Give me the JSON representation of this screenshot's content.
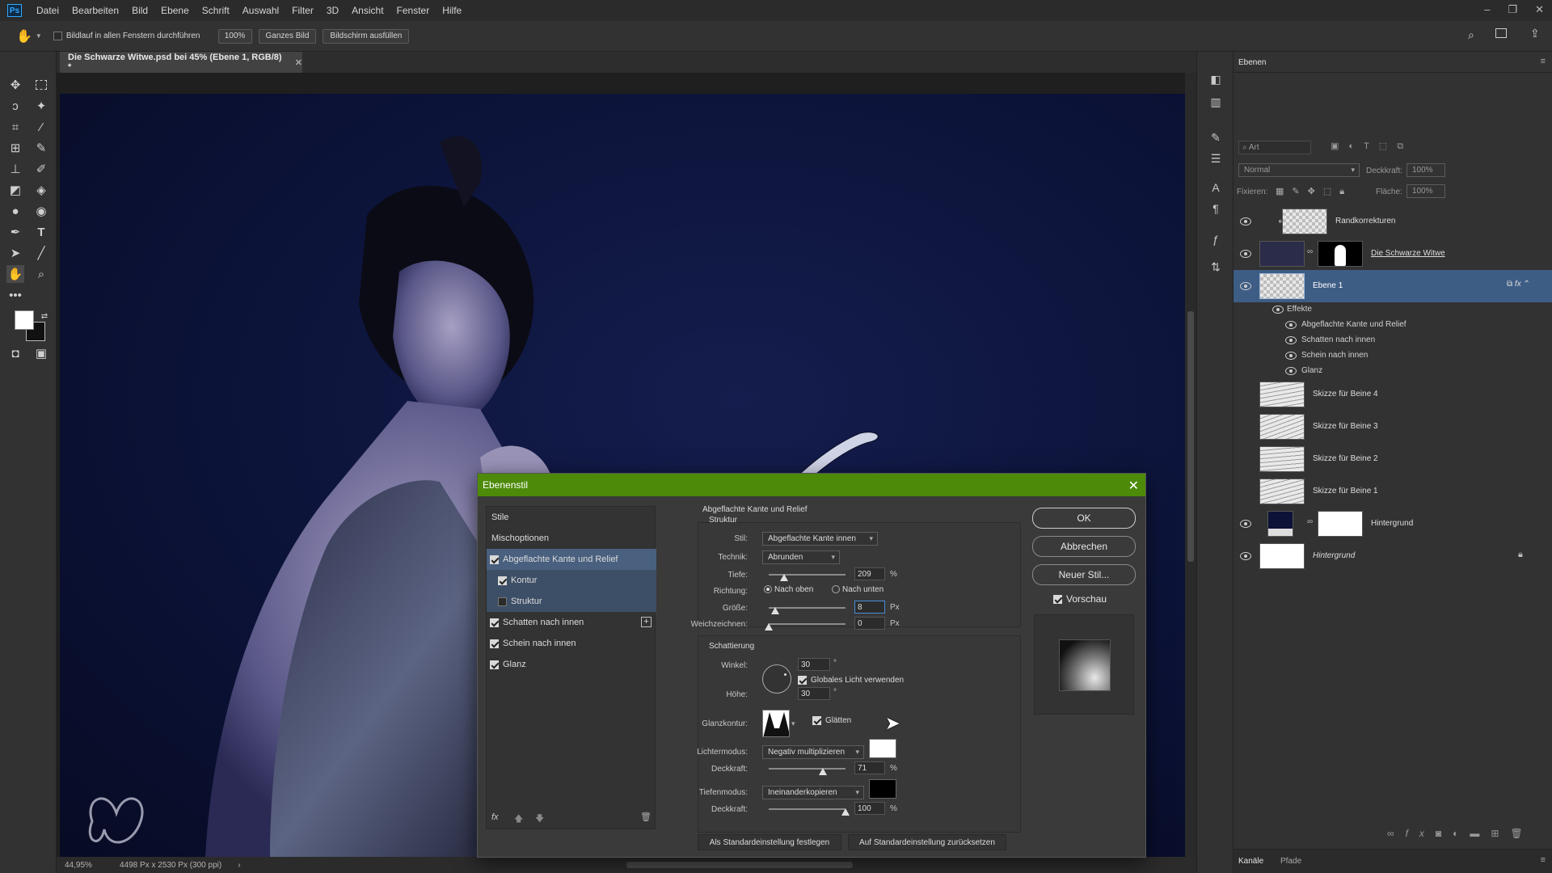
{
  "menu": {
    "logo": "Ps",
    "items": [
      "Datei",
      "Bearbeiten",
      "Bild",
      "Ebene",
      "Schrift",
      "Auswahl",
      "Filter",
      "3D",
      "Ansicht",
      "Fenster",
      "Hilfe"
    ]
  },
  "options": {
    "scroll_all_label": "Bildlauf in allen Fenstern durchführen",
    "zoom": "100%",
    "fit_label": "Ganzes Bild",
    "fill_label": "Bildschirm ausfüllen"
  },
  "document": {
    "tab_title": "Die Schwarze Witwe.psd bei 45% (Ebene 1, RGB/8) *",
    "zoom_status": "44,95%",
    "size_status": "4498 Px x 2530 Px (300 ppi)"
  },
  "layers_panel": {
    "title": "Ebenen",
    "search_placeholder": "Art",
    "blend_mode": "Normal",
    "opacity_label": "Deckkraft:",
    "opacity_value": "100%",
    "lock_label": "Fixieren:",
    "fill_label": "Fläche:",
    "fill_value": "100%",
    "layers": [
      {
        "name": "Randkorrekturen",
        "visible": true
      },
      {
        "name": "Die Schwarze Witwe",
        "visible": true
      },
      {
        "name": "Ebene 1",
        "visible": true,
        "selected": true
      },
      {
        "name": "Skizze für Beine 4",
        "visible": false
      },
      {
        "name": "Skizze für Beine 3",
        "visible": false
      },
      {
        "name": "Skizze für Beine 2",
        "visible": false
      },
      {
        "name": "Skizze für Beine 1",
        "visible": false
      },
      {
        "name": "Hintergrund",
        "visible": true
      },
      {
        "name": "Hintergrund",
        "visible": true,
        "locked": true
      }
    ],
    "effects_label": "Effekte",
    "effects": [
      "Abgeflachte Kante und Relief",
      "Schatten nach innen",
      "Schein nach innen",
      "Glanz"
    ],
    "bottom_tabs": [
      "Kanäle",
      "Pfade"
    ]
  },
  "dialog": {
    "title": "Ebenenstil",
    "styles_header": "Stile",
    "blend_options": "Mischoptionen",
    "style_items": [
      {
        "label": "Abgeflachte Kante und Relief",
        "checked": true
      },
      {
        "label": "Kontur",
        "checked": true
      },
      {
        "label": "Struktur",
        "checked": false
      },
      {
        "label": "Schatten nach innen",
        "checked": true
      },
      {
        "label": "Schein nach innen",
        "checked": true
      },
      {
        "label": "Glanz",
        "checked": true
      }
    ],
    "section_title": "Abgeflachte Kante und Relief",
    "section_sub": "Struktur",
    "stil_label": "Stil:",
    "stil_value": "Abgeflachte Kante innen",
    "technik_label": "Technik:",
    "technik_value": "Abrunden",
    "tiefe_label": "Tiefe:",
    "tiefe_value": "209",
    "tiefe_level": 0.2,
    "percent": "%",
    "richtung_label": "Richtung:",
    "richtung_up": "Nach oben",
    "richtung_down": "Nach unten",
    "groesse_label": "Größe:",
    "groesse_value": "8",
    "groesse_level": 0.08,
    "px": "Px",
    "weich_label": "Weichzeichnen:",
    "weich_value": "0",
    "weich_level": 0.0,
    "schattierung": "Schattierung",
    "winkel_label": "Winkel:",
    "winkel_value": "30",
    "deg": "°",
    "global_light": "Globales Licht verwenden",
    "hoehe_label": "Höhe:",
    "hoehe_value": "30",
    "glanz_label": "Glanzkontur:",
    "glaetten": "Glätten",
    "licht_label": "Lichtermodus:",
    "licht_value": "Negativ multiplizieren",
    "licht_color": "#ffffff",
    "deck1_label": "Deckkraft:",
    "deck1_value": "71",
    "deck1_level": 0.71,
    "tiefen_label": "Tiefenmodus:",
    "tiefen_value": "Ineinanderkopieren",
    "tiefen_color": "#000000",
    "deck2_label": "Deckkraft:",
    "deck2_value": "100",
    "deck2_level": 1.0,
    "btn_default_set": "Als Standardeinstellung festlegen",
    "btn_default_reset": "Auf Standardeinstellung zurücksetzen",
    "ok": "OK",
    "cancel": "Abbrechen",
    "new_style": "Neuer Stil...",
    "preview": "Vorschau",
    "fx": "fx"
  },
  "colors": {
    "dialog_title_bg": "#4d8a0a",
    "selected_layer": "#3e5d85"
  }
}
